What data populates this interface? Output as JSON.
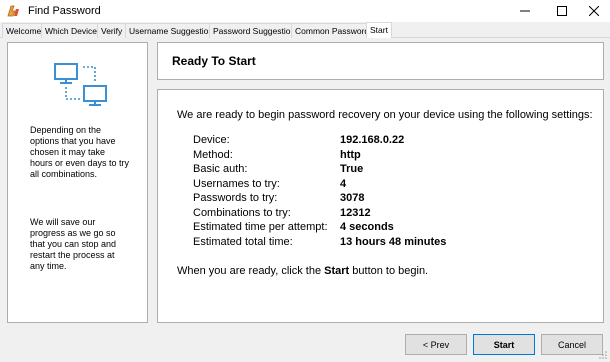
{
  "window": {
    "title": "Find Password"
  },
  "tabs": [
    "Welcome",
    "Which Device",
    "Verify",
    "Username Suggestions",
    "Password Suggestions",
    "Common Passwords",
    "Start"
  ],
  "active_tab": "Start",
  "left_panel": {
    "text1": "Depending on the options that you have chosen it may take hours or even days to try all combinations.",
    "text2": "We will save our progress as we go so that you can stop and restart the process at any time."
  },
  "header": {
    "title": "Ready To Start"
  },
  "main": {
    "intro": "We are ready to begin password recovery on your device using the following settings:",
    "settings": [
      {
        "label": "Device:",
        "value": "192.168.0.22"
      },
      {
        "label": "Method:",
        "value": "http"
      },
      {
        "label": "Basic auth:",
        "value": "True"
      },
      {
        "label": "Usernames to try:",
        "value": "4"
      },
      {
        "label": "Passwords to try:",
        "value": "3078"
      },
      {
        "label": "Combinations to try:",
        "value": "12312"
      },
      {
        "label": "Estimated time per attempt:",
        "value": "4 seconds"
      },
      {
        "label": "Estimated total time:",
        "value": "13 hours 48 minutes"
      }
    ],
    "outro_pre": "When you are ready, click the ",
    "outro_bold": "Start",
    "outro_post": " button to begin."
  },
  "footer": {
    "prev": "< Prev",
    "start": "Start",
    "cancel": "Cancel"
  },
  "colors": {
    "accent": "#0078d7",
    "panel_border": "#adadad",
    "chrome": "#f0f0f0",
    "icon_blue": "#3a8fd6"
  }
}
